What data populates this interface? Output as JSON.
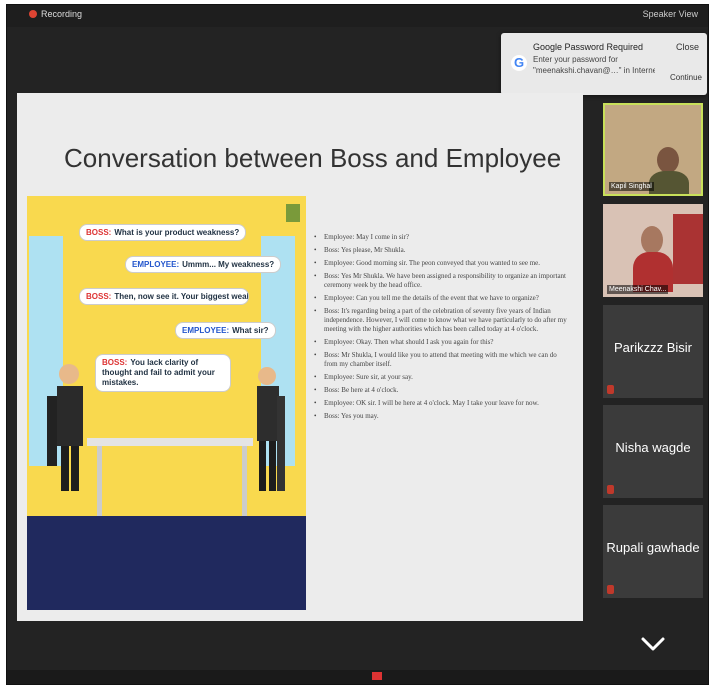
{
  "topbar": {
    "left_text": "Recording",
    "right_text": "Speaker View"
  },
  "popup": {
    "title": "Google Password Required",
    "line1": "Enter your password for",
    "line2": "\"meenakshi.chavan@…\" in Internet Accounts.",
    "close": "Close",
    "continue": "Continue",
    "icon": "google-g-icon"
  },
  "slide": {
    "title": "Conversation between Boss and Employee",
    "bubbles": [
      {
        "speaker": "BOSS:",
        "text": "What is your product weakness?"
      },
      {
        "speaker": "EMPLOYEE:",
        "text": "Ummm... My weakness?"
      },
      {
        "speaker": "BOSS:",
        "text": "Then, now see it. Your biggest weakness."
      },
      {
        "speaker": "EMPLOYEE:",
        "text": "What sir?"
      },
      {
        "speaker": "BOSS:",
        "text": "You lack clarity of thought and fail to admit your mistakes."
      }
    ],
    "bullets": [
      "Employee: May I come in sir?",
      "Boss: Yes please, Mr Shukla.",
      "Employee: Good morning sir. The peon conveyed that you wanted to see me.",
      "Boss: Yes Mr Shukla. We have been assigned a responsibility to organize an important ceremony week by the head office.",
      "Employee: Can you tell me the details of the event that we have to organize?",
      "Boss: It's regarding being a part of the celebration of seventy five years of Indian independence. However, I will come to know what we have particularly to do after my meeting with the higher authorities which has been called today at 4 o'clock.",
      "Employee: Okay. Then what should I ask you again for this?",
      "Boss: Mr Shukla, I would like you to attend that meeting with me which we can do from my chamber itself.",
      "Employee: Sure sir, at your say.",
      "Boss: Be here at 4 o'clock.",
      "Employee: OK sir. I will be here at 4 o'clock. May I take your leave for now.",
      "Boss: Yes you may."
    ]
  },
  "participants": [
    {
      "name": "Kapil Singhal",
      "video": true,
      "active": true
    },
    {
      "name": "Meenakshi Chav...",
      "video": true,
      "active": false
    },
    {
      "name": "Parikzzz Bisir",
      "video": false,
      "active": false
    },
    {
      "name": "Nisha wagde",
      "video": false,
      "active": false
    },
    {
      "name": "Rupali gawhade",
      "video": false,
      "active": false
    }
  ],
  "colors": {
    "active_border": "#c8e05a",
    "mic_muted": "#c0392b",
    "slide_bg": "#ececec"
  }
}
